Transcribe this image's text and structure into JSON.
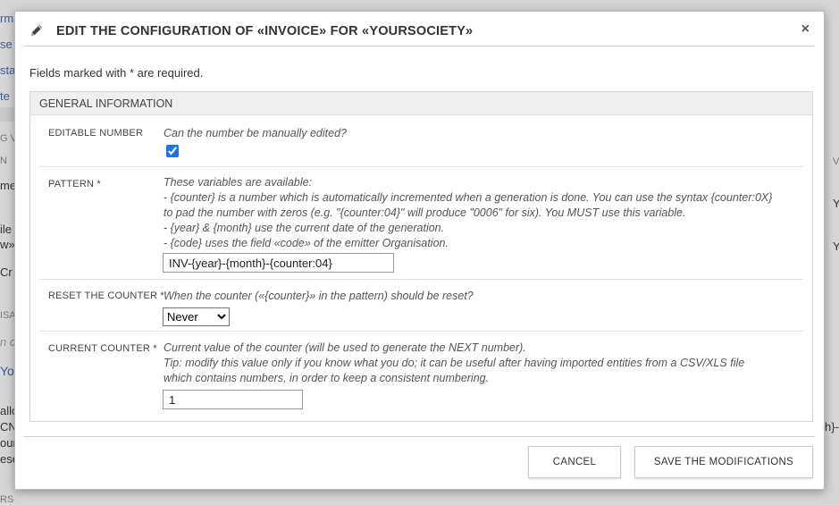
{
  "background": {
    "fragments_left": [
      "rm",
      "se",
      "sta",
      "te",
      "G V",
      "N",
      "me",
      "ile",
      "w»",
      "Cr",
      "ISA",
      "n c",
      "Yo",
      "allo",
      "CN",
      "our",
      "ese",
      "RS"
    ],
    "fragments_right": [
      "V",
      "Y",
      "Y",
      "h}-"
    ]
  },
  "modal": {
    "title": "EDIT THE CONFIGURATION OF «INVOICE» FOR «YOURSOCIETY»",
    "close_label": "×",
    "required_note": "Fields marked with * are required.",
    "section_title": "GENERAL INFORMATION",
    "fields": {
      "editable_number": {
        "label": "EDITABLE NUMBER",
        "help": "Can the number be manually edited?",
        "checked": true
      },
      "pattern": {
        "label": "PATTERN *",
        "help_lines": [
          "These variables are available:",
          "- {counter} is a number which is automatically incremented when a generation is done. You can use the syntax {counter:0X}",
          "to pad the number with zeros (e.g. \"{counter:04}\" will produce \"0006\" for six). You MUST use this variable.",
          "- {year} & {month} use the current date of the generation.",
          "- {code} uses the field «code» of the emitter Organisation."
        ],
        "value": "INV-{year}-{month}-{counter:04}"
      },
      "reset_counter": {
        "label": "RESET THE COUNTER *",
        "help": "When the counter («{counter}» in the pattern) should be reset?",
        "selected": "Never"
      },
      "current_counter": {
        "label": "CURRENT COUNTER *",
        "help_lines": [
          "Current value of the counter (will be used to generate the NEXT number).",
          "Tip: modify this value only if you know what you do; it can be useful after having imported entities from a CSV/XLS file",
          "which contains numbers, in order to keep a consistent numbering."
        ],
        "value": "1"
      }
    },
    "buttons": {
      "cancel": "CANCEL",
      "save": "SAVE THE MODIFICATIONS"
    }
  },
  "icons": {
    "header_icon": "pencil-icon",
    "close_icon": "close-icon"
  },
  "colors": {
    "overlay": "#d6d6d6",
    "link": "#3d5c9c",
    "checkbox": "#1a73e8"
  }
}
